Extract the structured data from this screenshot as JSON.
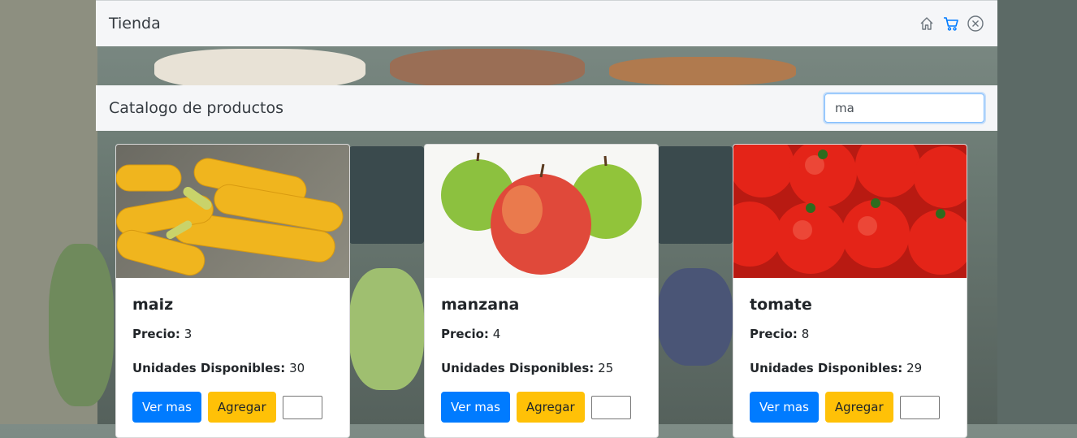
{
  "navbar": {
    "brand": "Tienda"
  },
  "catalog": {
    "title": "Catalogo de productos",
    "search_value": "ma"
  },
  "products": [
    {
      "name": "maiz",
      "price_label": "Precio:",
      "price": "3",
      "stock_label": "Unidades Disponibles:",
      "stock": "30",
      "details_label": "Ver mas",
      "add_label": "Agregar"
    },
    {
      "name": "manzana",
      "price_label": "Precio:",
      "price": "4",
      "stock_label": "Unidades Disponibles:",
      "stock": "25",
      "details_label": "Ver mas",
      "add_label": "Agregar"
    },
    {
      "name": "tomate",
      "price_label": "Precio:",
      "price": "8",
      "stock_label": "Unidades Disponibles:",
      "stock": "29",
      "details_label": "Ver mas",
      "add_label": "Agregar"
    }
  ],
  "icons": {
    "home": "home-icon",
    "cart": "cart-icon",
    "close": "close-circle-icon"
  },
  "colors": {
    "primary": "#007bff",
    "warning": "#ffc107",
    "cart_icon": "#007bff"
  }
}
